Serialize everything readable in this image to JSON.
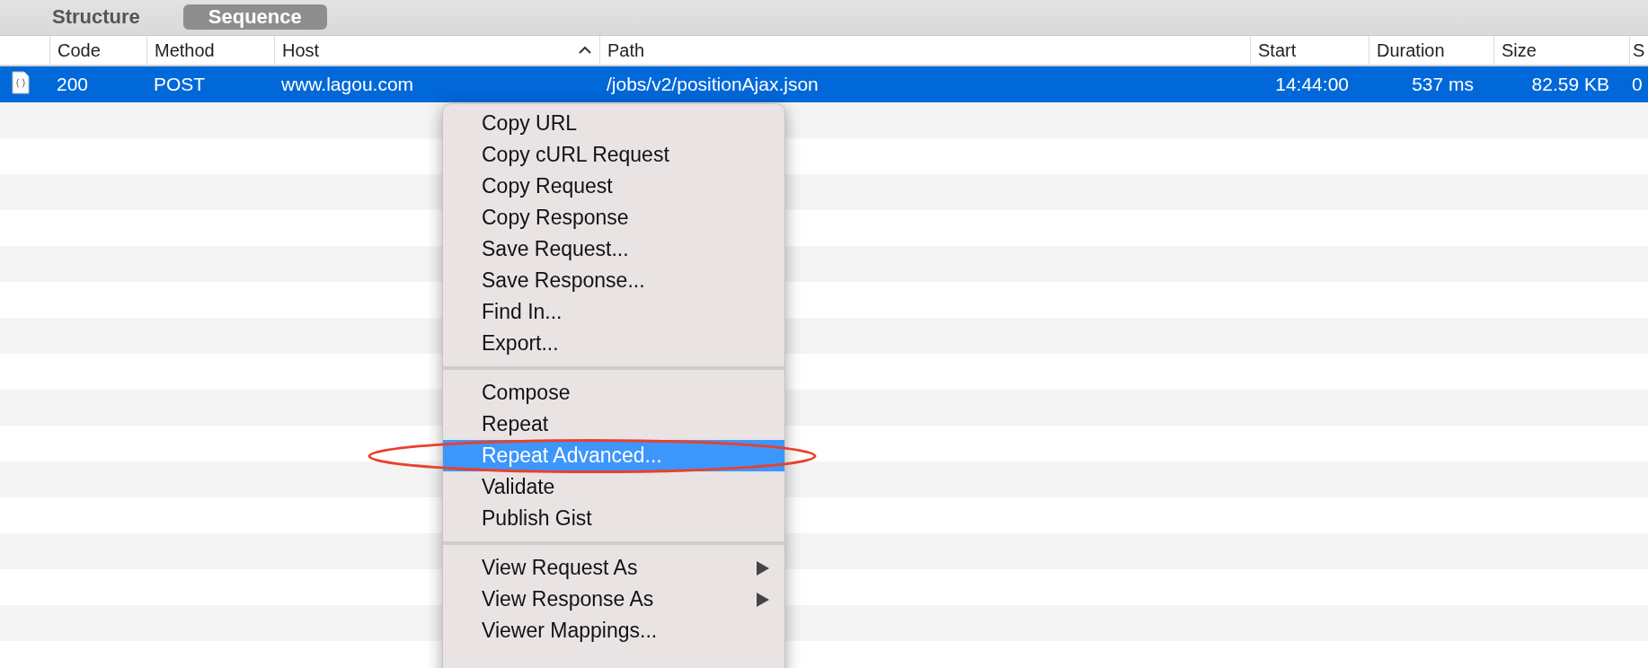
{
  "tabs": [
    {
      "label": "Structure",
      "selected": false
    },
    {
      "label": "Sequence",
      "selected": true
    }
  ],
  "table": {
    "columns": [
      {
        "label": "Code",
        "sorted": false
      },
      {
        "label": "Method",
        "sorted": false
      },
      {
        "label": "Host",
        "sorted": true
      },
      {
        "label": "Path",
        "sorted": false
      },
      {
        "label": "Start",
        "sorted": false
      },
      {
        "label": "Duration",
        "sorted": false
      },
      {
        "label": "Size",
        "sorted": false
      },
      {
        "label": "S",
        "sorted": false
      }
    ],
    "rows": [
      {
        "selected": true,
        "cells": [
          "200",
          "POST",
          "www.lagou.com",
          "/jobs/v2/positionAjax.json",
          "14:44:00",
          "537 ms",
          "82.59 KB",
          "0"
        ]
      }
    ]
  },
  "context_menu": {
    "items": [
      {
        "kind": "item",
        "label": "Copy URL",
        "selected": false
      },
      {
        "kind": "item",
        "label": "Copy cURL Request",
        "selected": false
      },
      {
        "kind": "item",
        "label": "Copy Request",
        "selected": false
      },
      {
        "kind": "item",
        "label": "Copy Response",
        "selected": false
      },
      {
        "kind": "item",
        "label": "Save Request...",
        "selected": false
      },
      {
        "kind": "item",
        "label": "Save Response...",
        "selected": false
      },
      {
        "kind": "item",
        "label": "Find In...",
        "selected": false
      },
      {
        "kind": "item",
        "label": "Export...",
        "selected": false
      },
      {
        "kind": "separator"
      },
      {
        "kind": "item",
        "label": "Compose",
        "selected": false
      },
      {
        "kind": "item",
        "label": "Repeat",
        "selected": false
      },
      {
        "kind": "item",
        "label": "Repeat Advanced...",
        "selected": true
      },
      {
        "kind": "item",
        "label": "Validate",
        "selected": false
      },
      {
        "kind": "item",
        "label": "Publish Gist",
        "selected": false
      },
      {
        "kind": "separator"
      },
      {
        "kind": "submenu",
        "label": "View Request As",
        "selected": false
      },
      {
        "kind": "submenu",
        "label": "View Response As",
        "selected": false
      },
      {
        "kind": "item",
        "label": "Viewer Mappings...",
        "selected": false
      }
    ]
  }
}
